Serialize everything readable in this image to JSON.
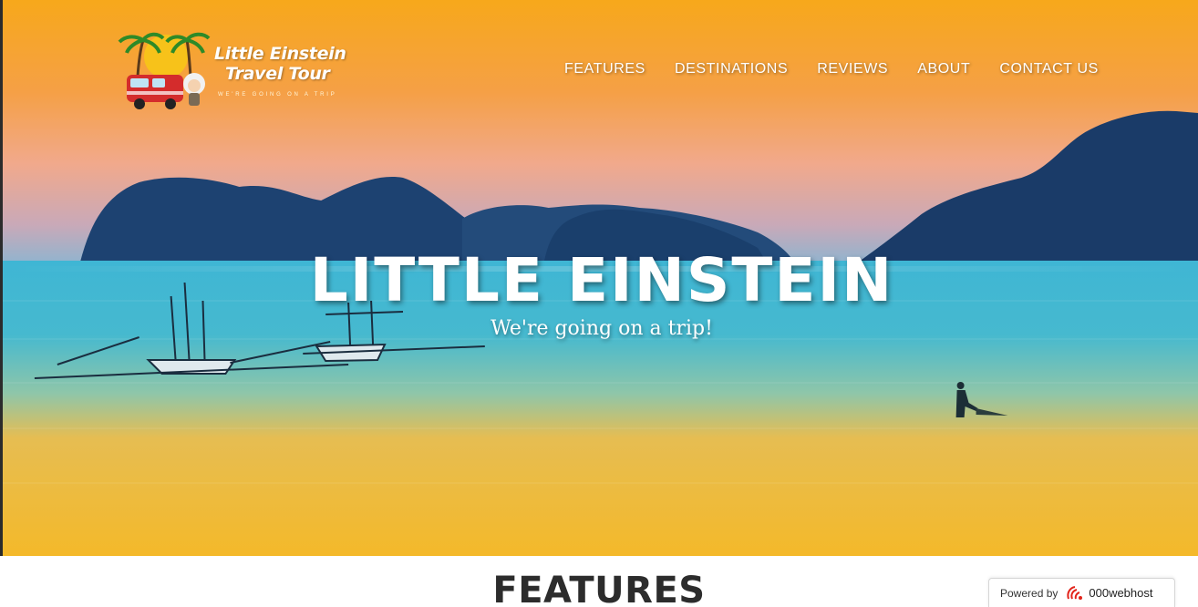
{
  "brand": {
    "title_line1": "Little Einstein",
    "title_line2": "Travel Tour",
    "tagline": "WE'RE GOING ON A TRIP"
  },
  "nav": {
    "items": [
      {
        "label": "FEATURES"
      },
      {
        "label": "DESTINATIONS"
      },
      {
        "label": "REVIEWS"
      },
      {
        "label": "ABOUT"
      },
      {
        "label": "CONTACT US"
      }
    ]
  },
  "hero": {
    "title": "LITTLE EINSTEIN",
    "subtitle": "We're going on a trip!"
  },
  "features": {
    "heading": "FEATURES"
  },
  "badge": {
    "label": "Powered by",
    "brand": "000webhost",
    "icon": "000webhost-logo-icon"
  },
  "colors": {
    "sky_top": "#f6a21a",
    "sky_mid": "#f2a56f",
    "mountains": "#1c3f6e",
    "sea": "#2fa9c8",
    "sand_water": "#f2b830",
    "heading_text": "#2c2c2c"
  }
}
